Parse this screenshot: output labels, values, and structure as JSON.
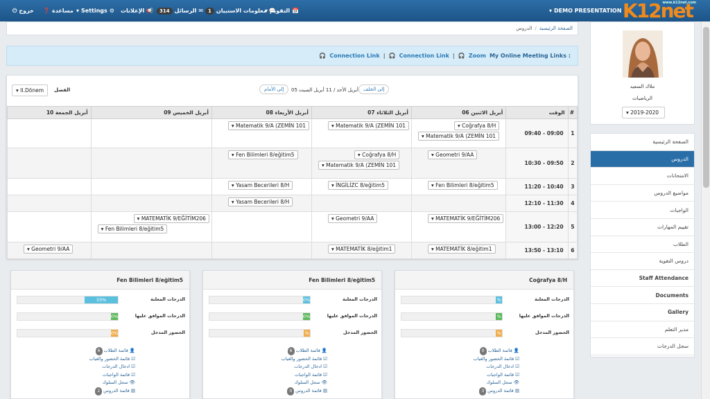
{
  "topbar": {
    "logout": "خروج",
    "help": "مساعدة",
    "settings": "Settings",
    "announcements": "الإعلانات",
    "messages_count": "314",
    "messages": "الرسائل",
    "info_count": "1",
    "info": "معلومات الاستبيان",
    "calendar": "التقويم",
    "presentation": "DEMO PRESENTATION",
    "logo_text": "K12net",
    "logo_url": "www.k12net.com"
  },
  "breadcrumb": {
    "home": "الصفحة الرئيسية",
    "sep": "/",
    "current": "الدروس"
  },
  "meeting": {
    "label": "My Online Meeting Links :",
    "zoom": "Zoom",
    "conn1": "Connection Link",
    "conn2": "Connection Link",
    "sep": "|"
  },
  "schedule": {
    "term_label": "الفصل",
    "term_value": "II.Dönem",
    "prev": "إلى الخلف",
    "range": "05 أبريل الأحد / 11 أبريل السبت",
    "next": "إلى الأمام",
    "headers": [
      "#",
      "الوقت",
      "06 أبريل الاثنين",
      "07 أبريل الثلاثاء",
      "08 أبريل الأربعاء",
      "09 أبريل الخميس",
      "10 أبريل الجمعة"
    ],
    "rows": [
      {
        "num": "1",
        "time": "09:40 - 09:00",
        "cells": [
          [
            "Coğrafya 8/H",
            "Matematik 9/A (ZEMİN 101"
          ],
          [
            "Matematik 9/A (ZEMİN 101"
          ],
          [
            "Matematik 9/A (ZEMİN 101"
          ],
          [],
          []
        ]
      },
      {
        "num": "2",
        "time": "10:30 - 09:50",
        "cells": [
          [
            "Geometri 9/AA"
          ],
          [
            "Coğrafya 8/H",
            "Matematik 9/A (ZEMİN 101"
          ],
          [
            "Fen Bilimleri 8/eğitim5"
          ],
          [],
          []
        ]
      },
      {
        "num": "3",
        "time": "11:20 - 10:40",
        "cells": [
          [
            "Fen Bilimleri 8/eğitim5"
          ],
          [
            "İNGİLİZC 8/eğitim5"
          ],
          [
            "Yasam Becerileri 8/H"
          ],
          [],
          []
        ]
      },
      {
        "num": "4",
        "time": "12:10 - 11:30",
        "cells": [
          [],
          [],
          [
            "Yasam Becerileri 8/H"
          ],
          [],
          []
        ]
      },
      {
        "num": "5",
        "time": "13:00 - 12:20",
        "cells": [
          [
            "MATEMATİK 9/EĞİTİM206"
          ],
          [
            "Geometri 9/AA"
          ],
          [],
          [
            "MATEMATİK 9/EĞİTİM206",
            "Fen Bilimleri 8/eğitim5"
          ],
          []
        ]
      },
      {
        "num": "6",
        "time": "13:50 - 13:10",
        "cells": [
          [
            "MATEMATİK 8/eğitim1"
          ],
          [
            "MATEMATİK 8/eğitim1"
          ],
          [],
          [],
          [
            "Geometri 9/AA"
          ]
        ]
      }
    ]
  },
  "cards": [
    {
      "title": "Coğrafya 8/H",
      "stats": [
        {
          "label": "الدرجات المعلنة",
          "value": "%",
          "fraction": 0.06,
          "color": "#5bc0de"
        },
        {
          "label": "الدرجات الموافق عليها",
          "value": "%",
          "fraction": 0.06,
          "color": "#5cb85c"
        },
        {
          "label": "الحضور المدخل",
          "value": "%",
          "fraction": 0.06,
          "color": "#f0ad4e"
        }
      ],
      "links": [
        {
          "label": "قائمة الطلاب",
          "count": "0"
        },
        {
          "label": "قائمة الحضور والغياب",
          "count": ""
        },
        {
          "label": "ادخال الدرجات",
          "count": ""
        },
        {
          "label": "قائمة الواجبات",
          "count": ""
        },
        {
          "label": "سجل السلوك",
          "count": ""
        },
        {
          "label": "قائمة الدروس",
          "count": "3"
        }
      ]
    },
    {
      "title": "Fen Bilimleri 8/eğitim5",
      "stats": [
        {
          "label": "الدرجات المعلنة",
          "value": "0%",
          "fraction": 0.07,
          "color": "#5bc0de"
        },
        {
          "label": "الدرجات الموافق عليها",
          "value": "0%",
          "fraction": 0.07,
          "color": "#5cb85c"
        },
        {
          "label": "الحضور المدخل",
          "value": "%",
          "fraction": 0.06,
          "color": "#f0ad4e"
        }
      ],
      "links": [
        {
          "label": "قائمة الطلاب",
          "count": "6"
        },
        {
          "label": "قائمة الحضور والغياب",
          "count": ""
        },
        {
          "label": "ادخال الدرجات",
          "count": ""
        },
        {
          "label": "قائمة الواجبات",
          "count": ""
        },
        {
          "label": "سجل السلوك",
          "count": ""
        },
        {
          "label": "قائمة الدروس",
          "count": "0"
        }
      ]
    },
    {
      "title": "Fen Bilimleri 8/eğitim5",
      "stats": [
        {
          "label": "الدرجات المعلنة",
          "value": "33%",
          "fraction": 0.33,
          "color": "#5bc0de"
        },
        {
          "label": "الدرجات الموافق عليها",
          "value": "0%",
          "fraction": 0.07,
          "color": "#5cb85c"
        },
        {
          "label": "الحضور المدخل",
          "value": "0%",
          "fraction": 0.07,
          "color": "#f0ad4e"
        }
      ],
      "links": [
        {
          "label": "قائمة الطلاب",
          "count": "6"
        },
        {
          "label": "قائمة الحضور والغياب",
          "count": ""
        },
        {
          "label": "ادخال الدرجات",
          "count": ""
        },
        {
          "label": "قائمة الواجبات",
          "count": ""
        },
        {
          "label": "سجل السلوك",
          "count": ""
        },
        {
          "label": "قائمة الدروس",
          "count": "2"
        }
      ]
    }
  ],
  "profile": {
    "name": "ملاك السعيد",
    "subject": "الرياضيات",
    "year": "2019-2020"
  },
  "menu": [
    {
      "label": "الصفحة الرئيسية",
      "active": false,
      "bold": false
    },
    {
      "label": "الدروس",
      "active": true,
      "bold": false
    },
    {
      "label": "الامتحانات",
      "active": false,
      "bold": false
    },
    {
      "label": "مواضيع الدروس",
      "active": false,
      "bold": false
    },
    {
      "label": "الواجبات",
      "active": false,
      "bold": false
    },
    {
      "label": "تقييم المهارات",
      "active": false,
      "bold": false
    },
    {
      "label": "الطلاب",
      "active": false,
      "bold": false
    },
    {
      "label": "دروس التقوية",
      "active": false,
      "bold": false
    },
    {
      "label": "Staff Attendance",
      "active": false,
      "bold": true
    },
    {
      "label": "Documents",
      "active": false,
      "bold": true
    },
    {
      "label": "Gallery",
      "active": false,
      "bold": true
    },
    {
      "label": "مدير التعلم",
      "active": false,
      "bold": false
    },
    {
      "label": "سجل الدرجات",
      "active": false,
      "bold": false
    }
  ]
}
